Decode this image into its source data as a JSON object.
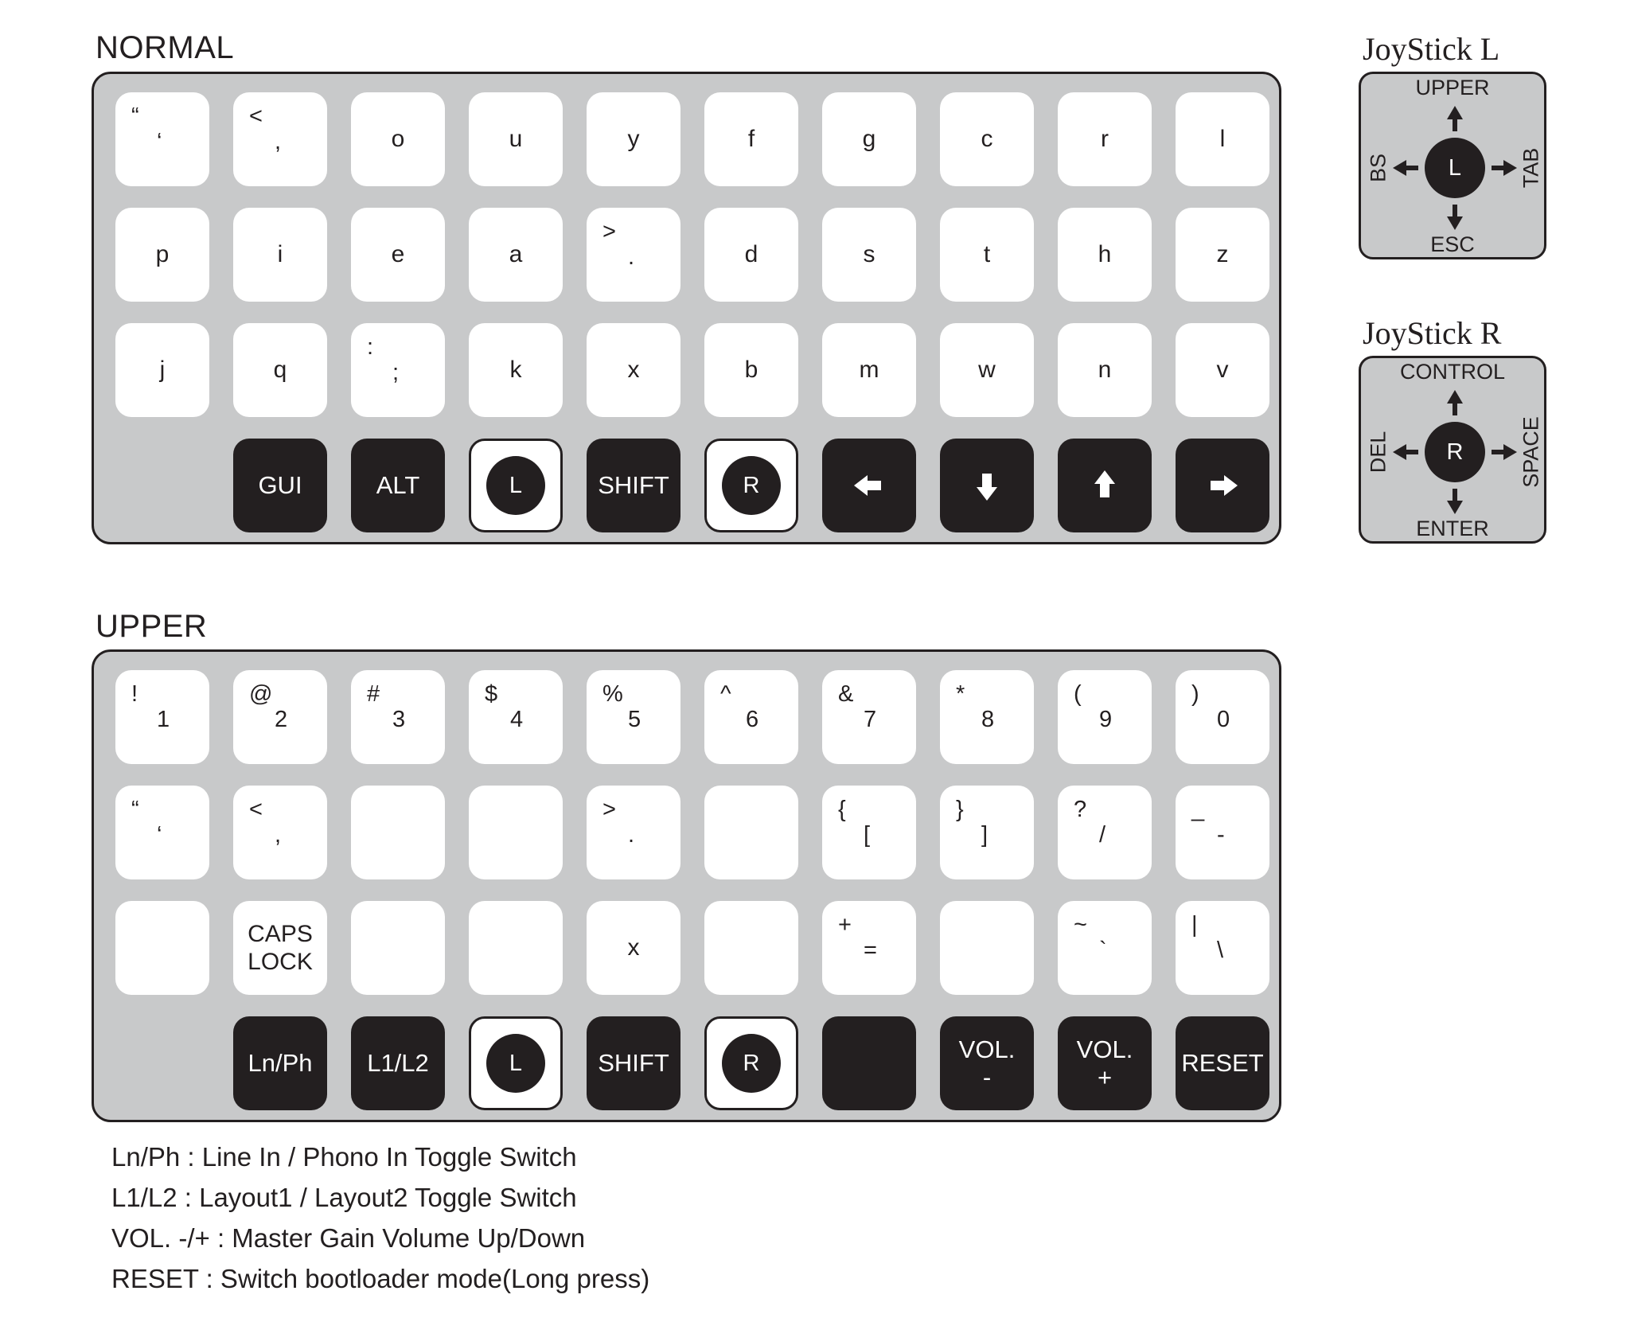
{
  "normal": {
    "title": "NORMAL",
    "rows": [
      [
        {
          "s": "“",
          "b": "‘"
        },
        {
          "s": "<",
          "b": ","
        },
        {
          "t": "o"
        },
        {
          "t": "u"
        },
        {
          "t": "y"
        },
        {
          "t": "f"
        },
        {
          "t": "g"
        },
        {
          "t": "c"
        },
        {
          "t": "r"
        },
        {
          "t": "l"
        }
      ],
      [
        {
          "t": "p"
        },
        {
          "t": "i"
        },
        {
          "t": "e"
        },
        {
          "t": "a"
        },
        {
          "s": ">",
          "b": "."
        },
        {
          "t": "d"
        },
        {
          "t": "s"
        },
        {
          "t": "t"
        },
        {
          "t": "h"
        },
        {
          "t": "z"
        }
      ],
      [
        {
          "t": "j"
        },
        {
          "t": "q"
        },
        {
          "s": ":",
          "b": ";"
        },
        {
          "t": "k"
        },
        {
          "t": "x"
        },
        {
          "t": "b"
        },
        {
          "t": "m"
        },
        {
          "t": "w"
        },
        {
          "t": "n"
        },
        {
          "t": "v"
        }
      ],
      [
        null,
        {
          "dark": true,
          "t": "GUI"
        },
        {
          "dark": true,
          "t": "ALT"
        },
        {
          "stick": "L"
        },
        {
          "dark": true,
          "t": "SHIFT"
        },
        {
          "stick": "R"
        },
        {
          "dark": true,
          "arrow": "left-arrow-icon"
        },
        {
          "dark": true,
          "arrow": "down-arrow-icon"
        },
        {
          "dark": true,
          "arrow": "up-arrow-icon"
        },
        {
          "dark": true,
          "arrow": "right-arrow-icon"
        }
      ]
    ]
  },
  "upper": {
    "title": "UPPER",
    "rows": [
      [
        {
          "s": "!",
          "b": "1"
        },
        {
          "s": "@",
          "b": "2"
        },
        {
          "s": "#",
          "b": "3"
        },
        {
          "s": "$",
          "b": "4"
        },
        {
          "s": "%",
          "b": "5"
        },
        {
          "s": "^",
          "b": "6"
        },
        {
          "s": "&",
          "b": "7"
        },
        {
          "s": "*",
          "b": "8"
        },
        {
          "s": "(",
          "b": "9"
        },
        {
          "s": ")",
          "b": "0"
        }
      ],
      [
        {
          "s": "“",
          "b": "‘"
        },
        {
          "s": "<",
          "b": ","
        },
        {},
        {},
        {
          "s": ">",
          "b": "."
        },
        {},
        {
          "s": "{",
          "b": "["
        },
        {
          "s": "}",
          "b": "]"
        },
        {
          "s": "?",
          "b": "/"
        },
        {
          "s": "_",
          "b": "-"
        }
      ],
      [
        {},
        {
          "st": "CAPS LOCK"
        },
        {},
        {},
        {
          "t": "x"
        },
        {},
        {
          "s": "+",
          "b": "="
        },
        {},
        {
          "s": "~",
          "b": "`"
        },
        {
          "s": "|",
          "b": "\\"
        }
      ],
      [
        null,
        {
          "dark": true,
          "t": "Ln/Ph"
        },
        {
          "dark": true,
          "t": "L1/L2"
        },
        {
          "stick": "L"
        },
        {
          "dark": true,
          "t": "SHIFT"
        },
        {
          "stick": "R"
        },
        {
          "dark": true
        },
        {
          "dark": true,
          "st": "VOL. -"
        },
        {
          "dark": true,
          "st": "VOL. +"
        },
        {
          "dark": true,
          "t": "RESET"
        }
      ]
    ]
  },
  "joystick_l": {
    "title": "JoyStick L",
    "center": "L",
    "up": "UPPER",
    "down": "ESC",
    "left": "BS",
    "right": "TAB"
  },
  "joystick_r": {
    "title": "JoyStick R",
    "center": "R",
    "up": "CONTROL",
    "down": "ENTER",
    "left": "DEL",
    "right": "SPACE"
  },
  "legend": [
    "Ln/Ph : Line In / Phono In Toggle Switch",
    "L1/L2 : Layout1 / Layout2 Toggle Switch",
    "VOL. -/+ : Master Gain Volume Up/Down",
    "RESET : Switch bootloader mode(Long press)"
  ]
}
